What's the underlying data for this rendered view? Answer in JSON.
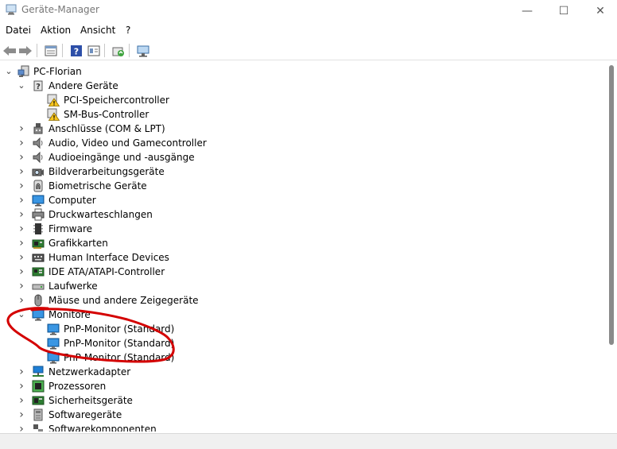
{
  "window": {
    "title": "Geräte-Manager",
    "minimize_glyph": "—",
    "maximize_glyph": "☐",
    "close_glyph": "✕"
  },
  "menu": [
    {
      "label": "Datei"
    },
    {
      "label": "Aktion"
    },
    {
      "label": "Ansicht"
    },
    {
      "label": "?"
    }
  ],
  "toolbar": {
    "buttons": [
      "back-icon",
      "forward-icon",
      "properties-icon",
      "help-icon",
      "details-view-icon",
      "update-driver-icon",
      "scan-hardware-icon"
    ]
  },
  "tree": {
    "root": {
      "label": "PC-Florian",
      "icon": "computer-icon",
      "expanded": true
    },
    "items": [
      {
        "label": "Andere Geräte",
        "icon": "unknown-device-icon",
        "expanded": true
      },
      {
        "label": "PCI-Speichercontroller",
        "icon": "warning-device-icon",
        "child": true
      },
      {
        "label": "SM-Bus-Controller",
        "icon": "warning-device-icon",
        "child": true
      },
      {
        "label": "Anschlüsse (COM & LPT)",
        "icon": "port-icon"
      },
      {
        "label": "Audio, Video und Gamecontroller",
        "icon": "speaker-icon"
      },
      {
        "label": "Audioeingänge und -ausgänge",
        "icon": "speaker-icon"
      },
      {
        "label": "Bildverarbeitungsgeräte",
        "icon": "camera-icon"
      },
      {
        "label": "Biometrische Geräte",
        "icon": "fingerprint-icon"
      },
      {
        "label": "Computer",
        "icon": "monitor-icon"
      },
      {
        "label": "Druckwarteschlangen",
        "icon": "printer-icon"
      },
      {
        "label": "Firmware",
        "icon": "chip-icon"
      },
      {
        "label": "Grafikkarten",
        "icon": "display-adapter-icon"
      },
      {
        "label": "Human Interface Devices",
        "icon": "keyboard-icon"
      },
      {
        "label": "IDE ATA/ATAPI-Controller",
        "icon": "controller-icon"
      },
      {
        "label": "Laufwerke",
        "icon": "drive-icon"
      },
      {
        "label": "Mäuse und andere Zeigegeräte",
        "icon": "mouse-icon"
      },
      {
        "label": "Monitore",
        "icon": "monitor-icon",
        "expanded": true
      },
      {
        "label": "PnP-Monitor (Standard)",
        "icon": "monitor-icon",
        "child": true
      },
      {
        "label": "PnP-Monitor (Standard)",
        "icon": "monitor-icon",
        "child": true
      },
      {
        "label": "PnP-Monitor (Standard)",
        "icon": "monitor-icon",
        "child": true
      },
      {
        "label": "Netzwerkadapter",
        "icon": "network-icon"
      },
      {
        "label": "Prozessoren",
        "icon": "processor-icon"
      },
      {
        "label": "Sicherheitsgeräte",
        "icon": "security-device-icon"
      },
      {
        "label": "Softwaregeräte",
        "icon": "software-device-icon"
      },
      {
        "label": "Softwarekomponenten",
        "icon": "component-icon"
      }
    ]
  },
  "colors": {
    "annotation": "#d40000",
    "monitor_blue": "#1e7fd6"
  }
}
